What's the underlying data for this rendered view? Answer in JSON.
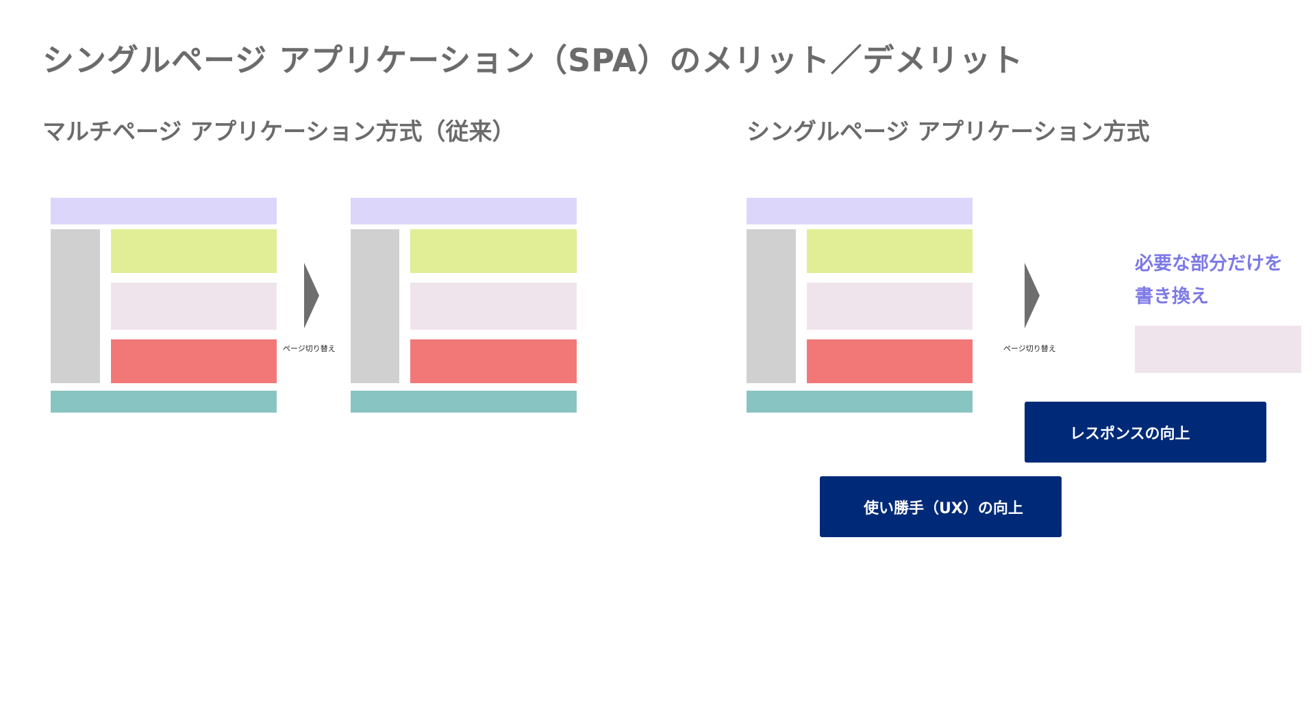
{
  "title": "シングルページ アプリケーション（SPA）のメリット／デメリット",
  "left_panel": {
    "heading": "マルチページ アプリケーション方式（従来）",
    "transition_label": "ページ切り替え"
  },
  "right_panel": {
    "heading": "シングルページ アプリケーション方式",
    "transition_label": "ページ切り替え",
    "rewrite_note_line1": "必要な部分だけを",
    "rewrite_note_line2": "書き換え"
  },
  "benefits": {
    "response": "レスポンスの向上",
    "usability": "使い勝手（UX）の向上"
  },
  "colors": {
    "header_block": "#dcd6fb",
    "sidebar_block": "#d0d0d0",
    "content_green": "#e1ee95",
    "content_pink": "#f0e4ec",
    "content_red": "#f27878",
    "footer_block": "#88c4c1",
    "arrow": "#6e6e6e",
    "note_text": "#7c79e6",
    "benefit_bg": "#002a78"
  }
}
